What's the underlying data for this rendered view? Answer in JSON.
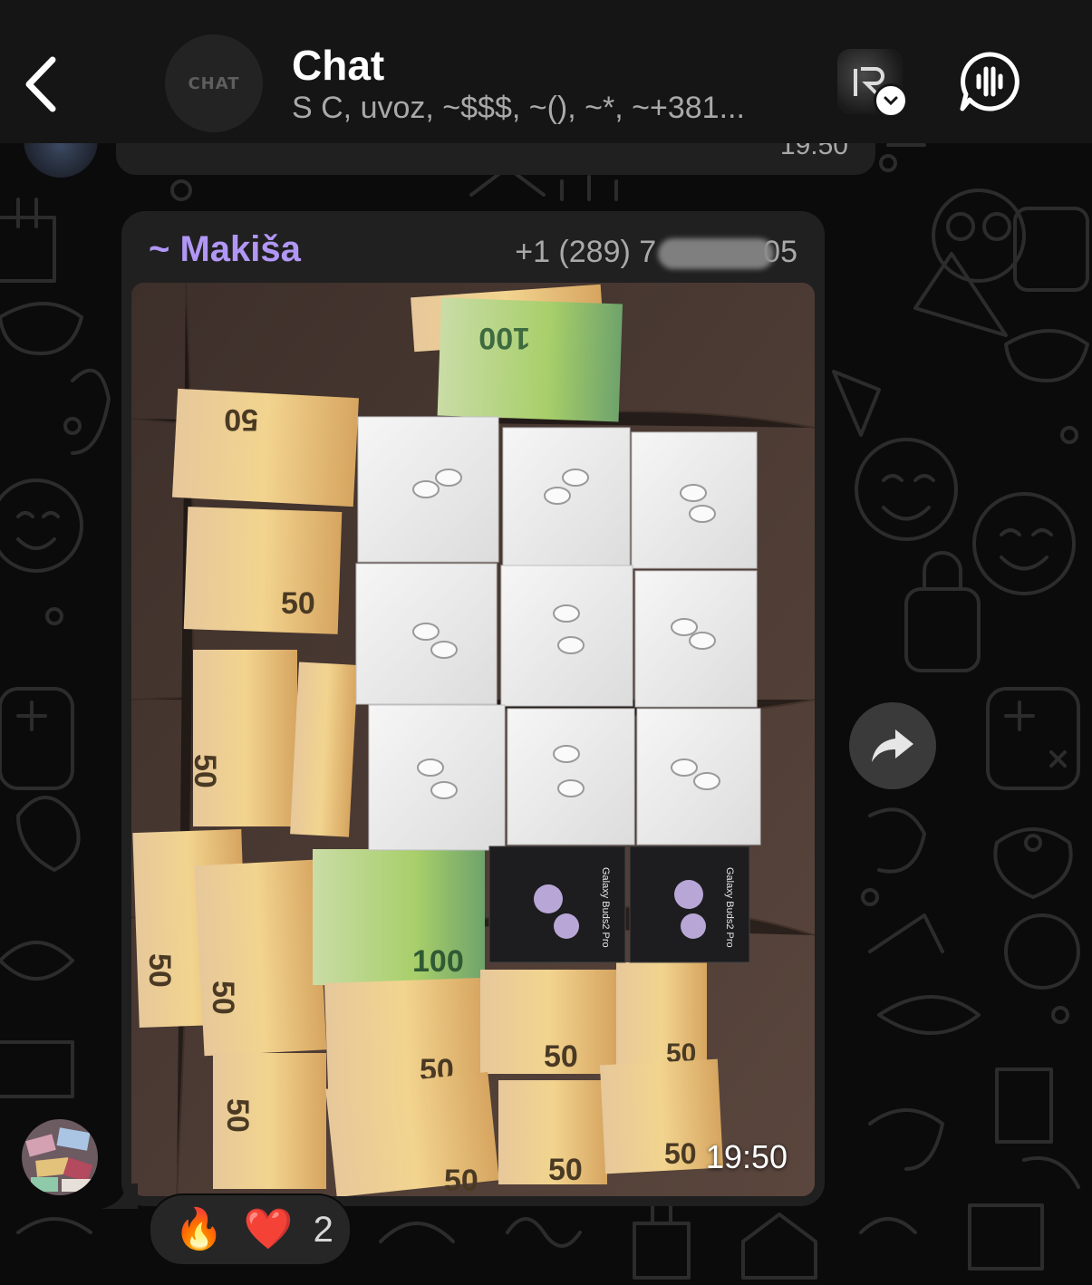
{
  "header": {
    "back_icon": "chevron-left-icon",
    "avatar_text": "CHAT",
    "title": "Chat",
    "subtitle": "S C, uvoz, ~$$$, ~(), ~*, ~+381...",
    "profile_icon": "profile-thumbnail",
    "call_icon": "voice-chat-icon"
  },
  "previous_message": {
    "time": "19:50"
  },
  "message": {
    "sender": "~ Makiša",
    "phone": "+1 (289) 7",
    "phone_end": "05",
    "time": "19:50",
    "accent_color": "#b197f5"
  },
  "reactions": {
    "emoji_1": "🔥",
    "emoji_2": "❤️",
    "count": "2"
  },
  "forward_icon": "forward-arrow-icon"
}
